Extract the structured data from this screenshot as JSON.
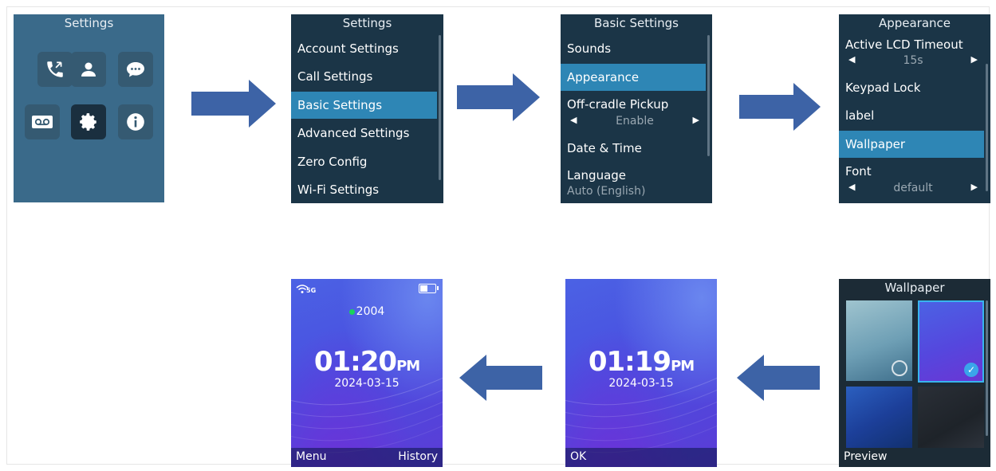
{
  "screen1": {
    "title": "Settings"
  },
  "screen2": {
    "title": "Settings",
    "items": [
      "Account Settings",
      "Call Settings",
      "Basic Settings",
      "Advanced Settings",
      "Zero Config",
      "Wi-Fi Settings"
    ]
  },
  "screen3": {
    "title": "Basic Settings",
    "sounds": "Sounds",
    "appearance": "Appearance",
    "offcradle": "Off-cradle Pickup",
    "offcradle_value": "Enable",
    "datetime": "Date & Time",
    "language": "Language",
    "language_value": "Auto (English)"
  },
  "screen4": {
    "title": "Appearance",
    "lcd_timeout": "Active LCD Timeout",
    "lcd_timeout_value": "15s",
    "keypad_lock": "Keypad Lock",
    "label": "label",
    "wallpaper": "Wallpaper",
    "font": "Font",
    "font_value": "default"
  },
  "screen5": {
    "title": "Wallpaper",
    "softkey": "Preview"
  },
  "screen6": {
    "time": "01:19",
    "ampm": "PM",
    "date": "2024-03-15",
    "softkey": "OK"
  },
  "screen7": {
    "network": "5G",
    "extension": "2004",
    "time": "01:20",
    "ampm": "PM",
    "date": "2024-03-15",
    "softkey_left": "Menu",
    "softkey_right": "History"
  },
  "colors": {
    "menu_bg": "#1b3547",
    "highlight": "#2e86b5",
    "arrow": "#3d63a6"
  },
  "arrow_svg": "arrow-right"
}
